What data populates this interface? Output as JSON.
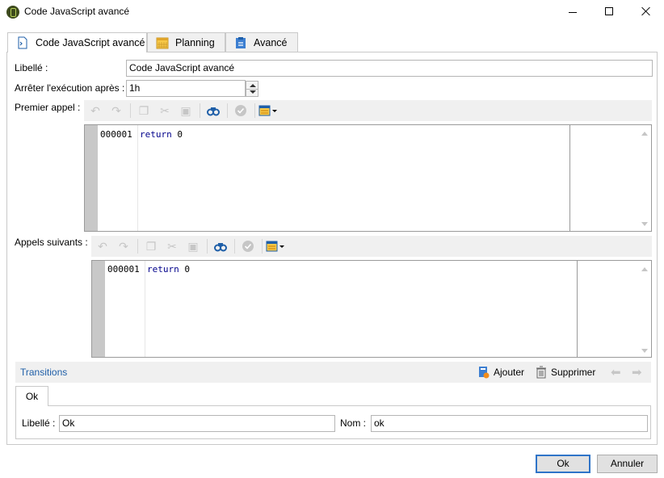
{
  "window": {
    "title": "Code JavaScript avancé"
  },
  "tabs": [
    {
      "label": "Code JavaScript avancé",
      "icon": "script-icon",
      "active": true
    },
    {
      "label": "Planning",
      "icon": "calendar-icon",
      "active": false
    },
    {
      "label": "Avancé",
      "icon": "clipboard-icon",
      "active": false
    }
  ],
  "form": {
    "label_label": "Libellé :",
    "label_value": "Code JavaScript avancé",
    "stop_after_label": "Arrêter l'exécution après :",
    "stop_after_value": "1h"
  },
  "first_call": {
    "label": "Premier appel :",
    "line_number": "000001",
    "code_keyword": "return",
    "code_value": "0"
  },
  "next_calls": {
    "label": "Appels suivants :",
    "line_number": "000001",
    "code_keyword": "return",
    "code_value": "0"
  },
  "transitions": {
    "label": "Transitions",
    "add_label": "Ajouter",
    "delete_label": "Supprimer",
    "tab_label": "Ok",
    "libelle_label": "Libellé :",
    "libelle_value": "Ok",
    "name_label": "Nom :",
    "name_value": "ok"
  },
  "buttons": {
    "ok": "Ok",
    "cancel": "Annuler"
  },
  "colors": {
    "accent": "#2f74c8",
    "toolbar_bg": "#f0f0f0",
    "gutter": "#c8c8c8",
    "keyword": "#00008b"
  }
}
